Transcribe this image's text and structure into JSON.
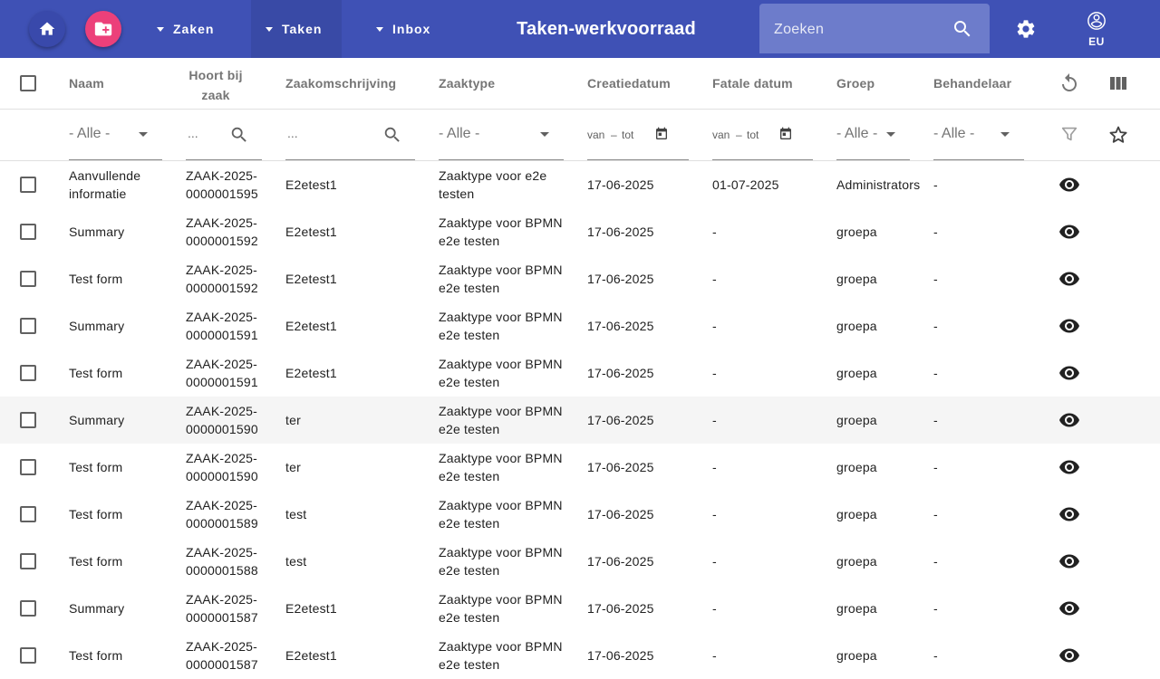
{
  "header": {
    "title": "Taken-werkvoorraad",
    "nav": [
      {
        "label": "Zaken",
        "active": false
      },
      {
        "label": "Taken",
        "active": true
      },
      {
        "label": "Inbox",
        "active": false
      }
    ],
    "search_placeholder": "Zoeken",
    "user_label": "EU",
    "colors": {
      "toolbar": "#3f51b5",
      "new_case_button": "#ec407a",
      "search_bg": "#6d7ccb"
    }
  },
  "table": {
    "columns": {
      "naam": "Naam",
      "hoort_bij_zaak_1": "Hoort bij",
      "hoort_bij_zaak_2": "zaak",
      "zaakomschrijving": "Zaakomschrijving",
      "zaaktype": "Zaaktype",
      "creatiedatum": "Creatiedatum",
      "fatale_datum": "Fatale datum",
      "groep": "Groep",
      "behandelaar": "Behandelaar"
    },
    "filters": {
      "naam": "- Alle -",
      "zaak_placeholder": "...",
      "omschrijving_placeholder": "...",
      "zaaktype": "- Alle -",
      "van": "van",
      "dash": "–",
      "tot": "tot",
      "groep": "- Alle -",
      "behandelaar": "- Alle -"
    },
    "rows": [
      {
        "naam1": "Aanvullende",
        "naam2": "informatie",
        "zaak1": "ZAAK-2025-",
        "zaak2": "0000001595",
        "omschrijving": "E2etest1",
        "type1": "Zaaktype voor e2e",
        "type2": "testen",
        "creatie": "17-06-2025",
        "fataal": "01-07-2025",
        "groep": "Administrators",
        "behandelaar": "-"
      },
      {
        "naam1": "Summary",
        "naam2": "",
        "zaak1": "ZAAK-2025-",
        "zaak2": "0000001592",
        "omschrijving": "E2etest1",
        "type1": "Zaaktype voor BPMN",
        "type2": "e2e testen",
        "creatie": "17-06-2025",
        "fataal": "-",
        "groep": "groepa",
        "behandelaar": "-"
      },
      {
        "naam1": "Test form",
        "naam2": "",
        "zaak1": "ZAAK-2025-",
        "zaak2": "0000001592",
        "omschrijving": "E2etest1",
        "type1": "Zaaktype voor BPMN",
        "type2": "e2e testen",
        "creatie": "17-06-2025",
        "fataal": "-",
        "groep": "groepa",
        "behandelaar": "-"
      },
      {
        "naam1": "Summary",
        "naam2": "",
        "zaak1": "ZAAK-2025-",
        "zaak2": "0000001591",
        "omschrijving": "E2etest1",
        "type1": "Zaaktype voor BPMN",
        "type2": "e2e testen",
        "creatie": "17-06-2025",
        "fataal": "-",
        "groep": "groepa",
        "behandelaar": "-"
      },
      {
        "naam1": "Test form",
        "naam2": "",
        "zaak1": "ZAAK-2025-",
        "zaak2": "0000001591",
        "omschrijving": "E2etest1",
        "type1": "Zaaktype voor BPMN",
        "type2": "e2e testen",
        "creatie": "17-06-2025",
        "fataal": "-",
        "groep": "groepa",
        "behandelaar": "-"
      },
      {
        "naam1": "Summary",
        "naam2": "",
        "zaak1": "ZAAK-2025-",
        "zaak2": "0000001590",
        "omschrijving": "ter",
        "type1": "Zaaktype voor BPMN",
        "type2": "e2e testen",
        "creatie": "17-06-2025",
        "fataal": "-",
        "groep": "groepa",
        "behandelaar": "-",
        "highlighted": true
      },
      {
        "naam1": "Test form",
        "naam2": "",
        "zaak1": "ZAAK-2025-",
        "zaak2": "0000001590",
        "omschrijving": "ter",
        "type1": "Zaaktype voor BPMN",
        "type2": "e2e testen",
        "creatie": "17-06-2025",
        "fataal": "-",
        "groep": "groepa",
        "behandelaar": "-"
      },
      {
        "naam1": "Test form",
        "naam2": "",
        "zaak1": "ZAAK-2025-",
        "zaak2": "0000001589",
        "omschrijving": "test",
        "type1": "Zaaktype voor BPMN",
        "type2": "e2e testen",
        "creatie": "17-06-2025",
        "fataal": "-",
        "groep": "groepa",
        "behandelaar": "-"
      },
      {
        "naam1": "Test form",
        "naam2": "",
        "zaak1": "ZAAK-2025-",
        "zaak2": "0000001588",
        "omschrijving": "test",
        "type1": "Zaaktype voor BPMN",
        "type2": "e2e testen",
        "creatie": "17-06-2025",
        "fataal": "-",
        "groep": "groepa",
        "behandelaar": "-"
      },
      {
        "naam1": "Summary",
        "naam2": "",
        "zaak1": "ZAAK-2025-",
        "zaak2": "0000001587",
        "omschrijving": "E2etest1",
        "type1": "Zaaktype voor BPMN",
        "type2": "e2e testen",
        "creatie": "17-06-2025",
        "fataal": "-",
        "groep": "groepa",
        "behandelaar": "-"
      },
      {
        "naam1": "Test form",
        "naam2": "",
        "zaak1": "ZAAK-2025-",
        "zaak2": "0000001587",
        "omschrijving": "E2etest1",
        "type1": "Zaaktype voor BPMN",
        "type2": "e2e testen",
        "creatie": "17-06-2025",
        "fataal": "-",
        "groep": "groepa",
        "behandelaar": "-"
      }
    ]
  }
}
